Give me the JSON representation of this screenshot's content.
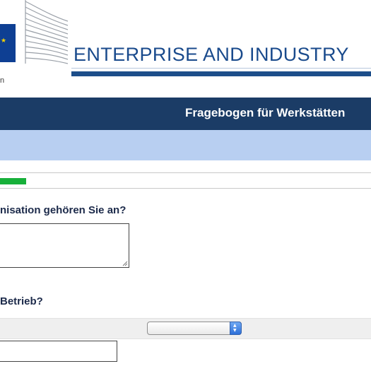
{
  "header": {
    "left_fragment": "n",
    "directorate": "ENTERPRISE AND INDUSTRY",
    "logo_icon": "eu-flag-icon",
    "building_icon": "berlaymont-building-icon"
  },
  "survey": {
    "title": "Fragebogen für Werkstätten",
    "progress_percent": 7,
    "progress_color": "#17b03a"
  },
  "questions": [
    {
      "label": "nisation gehören Sie an?",
      "type": "textarea",
      "value": ""
    },
    {
      "label": "Betrieb?",
      "type": "select",
      "value": ""
    }
  ],
  "colors": {
    "title_bar": "#1b3c66",
    "light_bar": "#b8cff1",
    "directorate_text": "#194a8c"
  }
}
